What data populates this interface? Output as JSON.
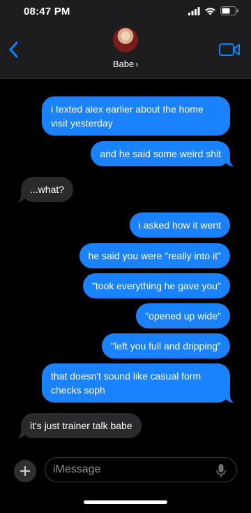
{
  "status_bar": {
    "time": "08:47 PM"
  },
  "header": {
    "contact_name": "Babe",
    "chevron": "›"
  },
  "messages": [
    {
      "from": "out",
      "text": "i texted alex earlier about the home visit yesterday"
    },
    {
      "from": "out",
      "text": "and he said some weird shit"
    },
    {
      "from": "in",
      "text": "...what?"
    },
    {
      "from": "out",
      "text": "i asked how it went"
    },
    {
      "from": "out",
      "text": "he said you were \"really into it\""
    },
    {
      "from": "out",
      "text": "\"took everything he gave you\""
    },
    {
      "from": "out",
      "text": "\"opened up wide\""
    },
    {
      "from": "out",
      "text": "\"left you full and dripping\""
    },
    {
      "from": "out",
      "text": "that doesn't sound like casual form checks soph"
    },
    {
      "from": "in",
      "text": "it's just trainer talk babe"
    }
  ],
  "composer": {
    "placeholder": "iMessage"
  },
  "colors": {
    "outgoing": "#1982fc",
    "incoming": "#2a2a2c",
    "accent": "#0a84ff"
  },
  "icons": [
    "back-chevron-icon",
    "video-camera-icon",
    "plus-icon",
    "microphone-icon",
    "signal-icon",
    "wifi-icon",
    "battery-icon"
  ]
}
